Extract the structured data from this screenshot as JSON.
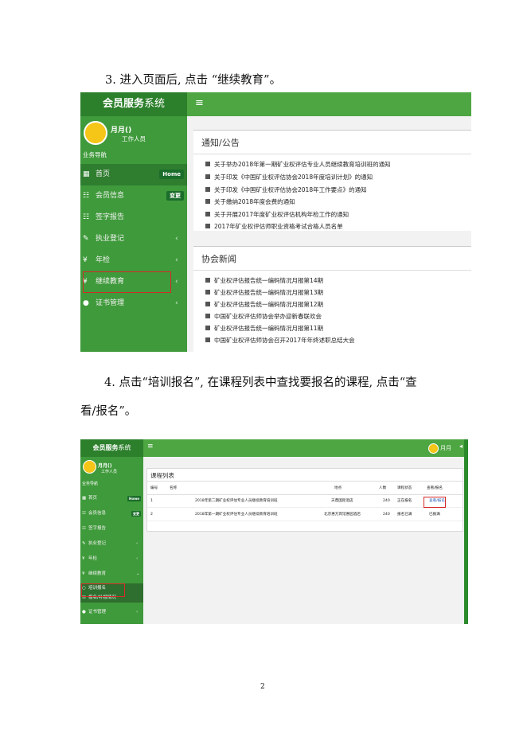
{
  "steps": {
    "step3": "3. 进入页面后, 点击 “继续教育”。",
    "step4_line1": "4. 点击“培训报名”, 在课程列表中查找要报名的课程, 点击“查",
    "step4_line2": "看/报名”。"
  },
  "screenshot1": {
    "logo_bold": "会员服务",
    "logo_thin": "系统",
    "hamburger": "≡",
    "user_name": "月月(",
    "user_name_red": "",
    "user_name_close": ")",
    "user_role": "工作人员",
    "nav_header": "业务导航",
    "nav": [
      {
        "icon": "▦",
        "label": "首页",
        "badge": "Home",
        "arrow": ""
      },
      {
        "icon": "☷",
        "label": "会员信息",
        "badge": "变更",
        "arrow": ""
      },
      {
        "icon": "☷",
        "label": "签字报告",
        "badge": "",
        "arrow": ""
      },
      {
        "icon": "✎",
        "label": "执业登记",
        "badge": "",
        "arrow": "‹"
      },
      {
        "icon": "¥",
        "label": "年检",
        "badge": "",
        "arrow": "‹"
      },
      {
        "icon": "¥",
        "label": "继续教育",
        "badge": "",
        "arrow": "‹"
      },
      {
        "icon": "●",
        "label": "证书管理",
        "badge": "",
        "arrow": "‹"
      }
    ],
    "notice": {
      "title": "通知/公告",
      "items": [
        "关于举办2018年第一期矿业权评估专业人员继续教育培训班的通知",
        "关于印发《中国矿业权评估协会2018年度培训计划》的通知",
        "关于印发《中国矿业权评估协会2018年工作要点》的通知",
        "关于缴纳2018年度会费的通知",
        "关于开展2017年度矿业权评估机构年检工作的通知",
        "2017年矿业权评估师职业资格考试合格人员名单"
      ]
    },
    "news": {
      "title": "协会新闻",
      "items": [
        "矿业权评估报告统一编码情况月报第14期",
        "矿业权评估报告统一编码情况月报第13期",
        "矿业权评估报告统一编码情况月报第12期",
        "中国矿业权评估师协会举办迎新春联欢会",
        "矿业权评估报告统一编码情况月报第11期",
        "中国矿业权评估师协会召开2017年年终述职总结大会"
      ]
    }
  },
  "screenshot2": {
    "logo_bold": "会员服务",
    "logo_thin": "系统",
    "hamburger": "≡",
    "top_user": "月月",
    "top_icon": "◂",
    "user_name": "月月(",
    "user_name_red": "",
    "user_name_close": ")",
    "user_role": "工作人员",
    "nav_header": "业务导航",
    "nav": [
      {
        "icon": "▦",
        "label": "首页",
        "badge": "Home",
        "arrow": ""
      },
      {
        "icon": "☷",
        "label": "会员信息",
        "badge": "变更",
        "arrow": ""
      },
      {
        "icon": "☷",
        "label": "签字报告",
        "badge": "",
        "arrow": ""
      },
      {
        "icon": "✎",
        "label": "执业登记",
        "badge": "",
        "arrow": "‹"
      },
      {
        "icon": "¥",
        "label": "年检",
        "badge": "",
        "arrow": "‹"
      },
      {
        "icon": "¥",
        "label": "继续教育",
        "badge": "",
        "arrow": "⌄"
      },
      {
        "icon": "○",
        "label": "培训报名",
        "badge": "",
        "arrow": ""
      },
      {
        "icon": "☷",
        "label": "报名/补报情况",
        "badge": "",
        "arrow": ""
      },
      {
        "icon": "●",
        "label": "证书管理",
        "badge": "",
        "arrow": "‹"
      }
    ],
    "course_list": {
      "title": "课程列表",
      "headers": [
        "编号",
        "名称",
        "地点",
        "人数",
        "课程状态",
        "查看/报名"
      ],
      "rows": [
        {
          "no": "1",
          "name": "2018年第二期矿业权评估专业人员继续教育培训班",
          "place": "天鼎国际酒店",
          "count": "240",
          "status": "正在报名",
          "action": "查看/报名"
        },
        {
          "no": "2",
          "name": "2018年第一期矿业权评估专业人员继续教育培训班",
          "place": "北京惠方宾馆惠园酒店",
          "count": "240",
          "status": "报名已满",
          "action": "已报满"
        }
      ]
    }
  },
  "page_number": "2",
  "colors": {
    "sidebar": "#3f9a3b",
    "logo_bar": "#2c7f2b",
    "topbar": "#4da642",
    "highlight": "#d62a2a"
  }
}
